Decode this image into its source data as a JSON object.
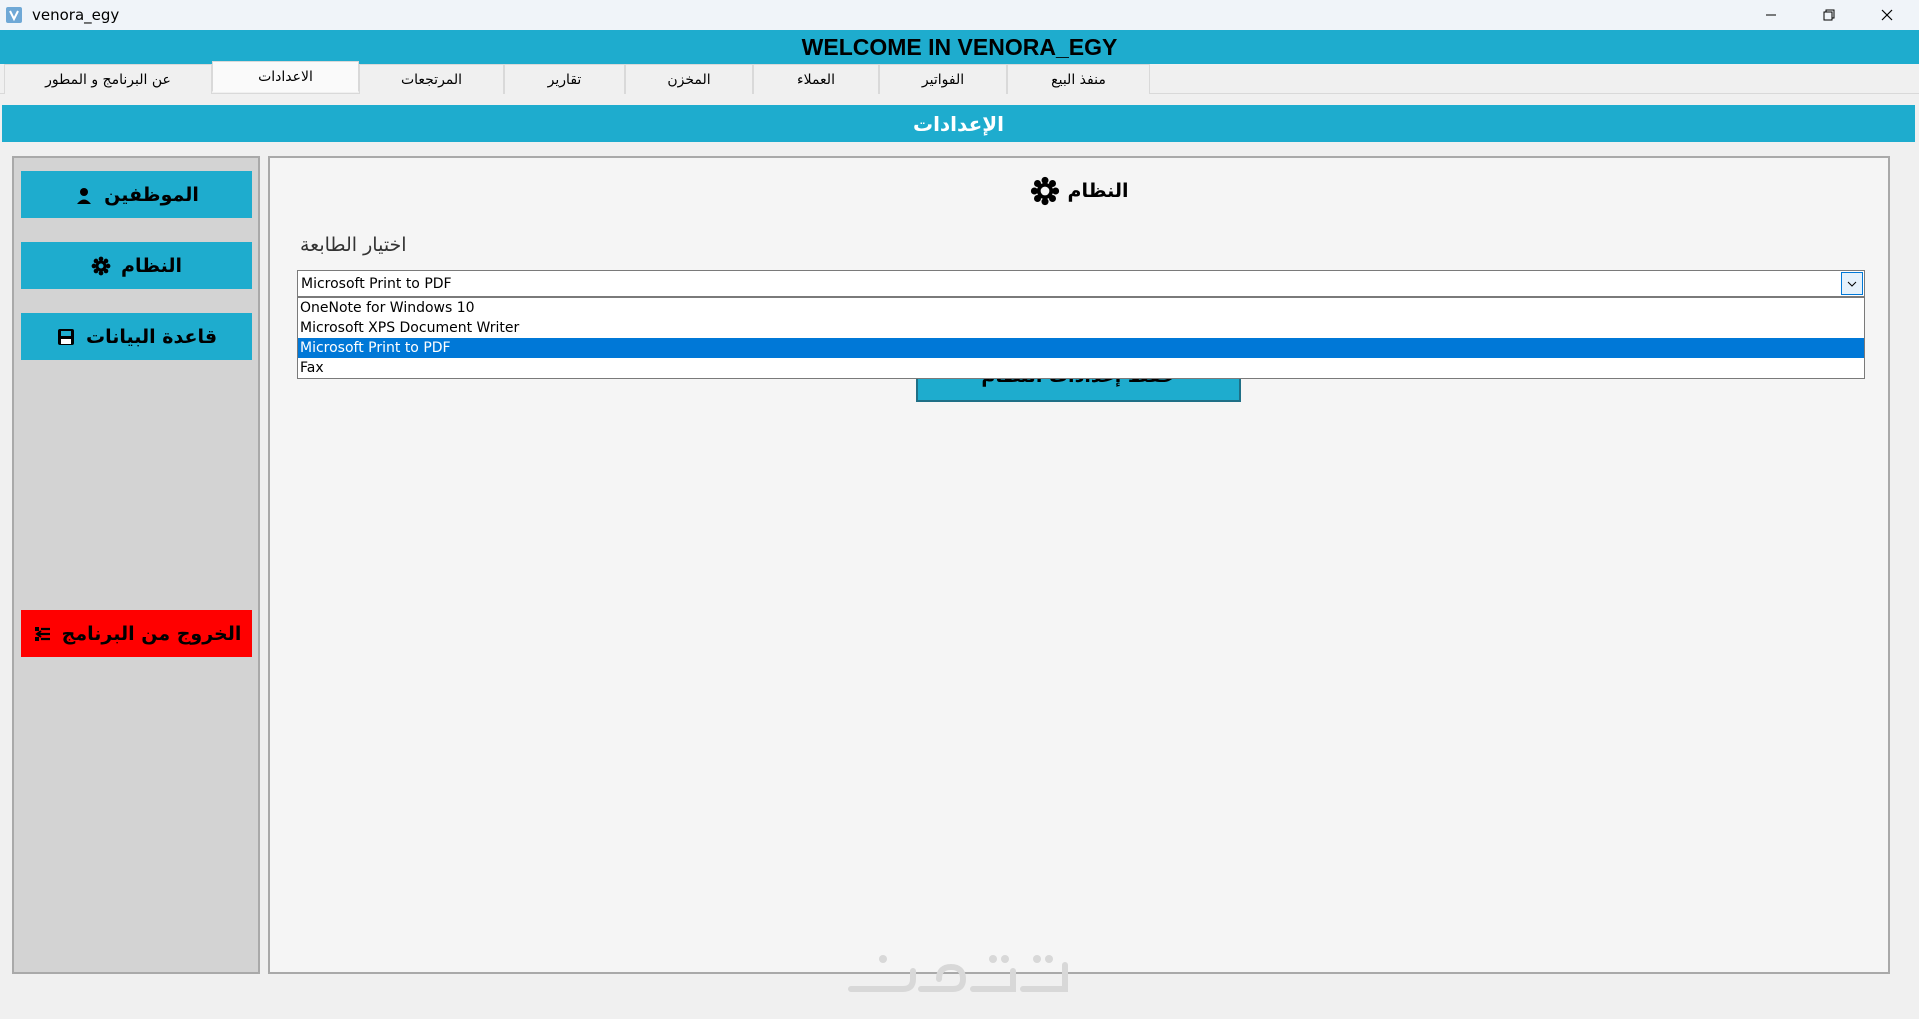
{
  "window": {
    "title": "venora_egy",
    "controls": [
      "minimize-icon",
      "restore-icon",
      "close-icon"
    ]
  },
  "banner": {
    "text": "WELCOME IN VENORA_EGY"
  },
  "tabs": [
    {
      "label": "منفذ البيع",
      "active": false
    },
    {
      "label": "الفواتير",
      "active": false
    },
    {
      "label": "العملاء",
      "active": false
    },
    {
      "label": "المخزن",
      "active": false
    },
    {
      "label": "تقارير",
      "active": false
    },
    {
      "label": "المرتجعات",
      "active": false
    },
    {
      "label": "الاعدادات",
      "active": true
    },
    {
      "label": "عن البرنامج و المطور",
      "active": false
    }
  ],
  "section": {
    "title": "الإعدادات"
  },
  "sidebar": {
    "employees": {
      "label": "الموظفين",
      "icon": "user-icon"
    },
    "system": {
      "label": "النظام",
      "icon": "gear-icon"
    },
    "database": {
      "label": "قاعدة البيانات",
      "icon": "save-icon"
    },
    "exit": {
      "label": "الخروج من البرنامج",
      "icon": "exit-icon"
    }
  },
  "panel": {
    "title": "النظام",
    "title_icon": "gear-icon",
    "printer_label": "اختيار الطابعة",
    "printer_selected": "Microsoft Print to PDF",
    "printer_options": [
      "OneNote for Windows 10",
      "Microsoft XPS Document Writer",
      "Microsoft Print to PDF",
      "Fax"
    ],
    "save_label": "حفظ إعدادات النظام"
  },
  "colors": {
    "accent": "#1eacce",
    "exit": "#ff0000",
    "selection": "#0078d7"
  }
}
